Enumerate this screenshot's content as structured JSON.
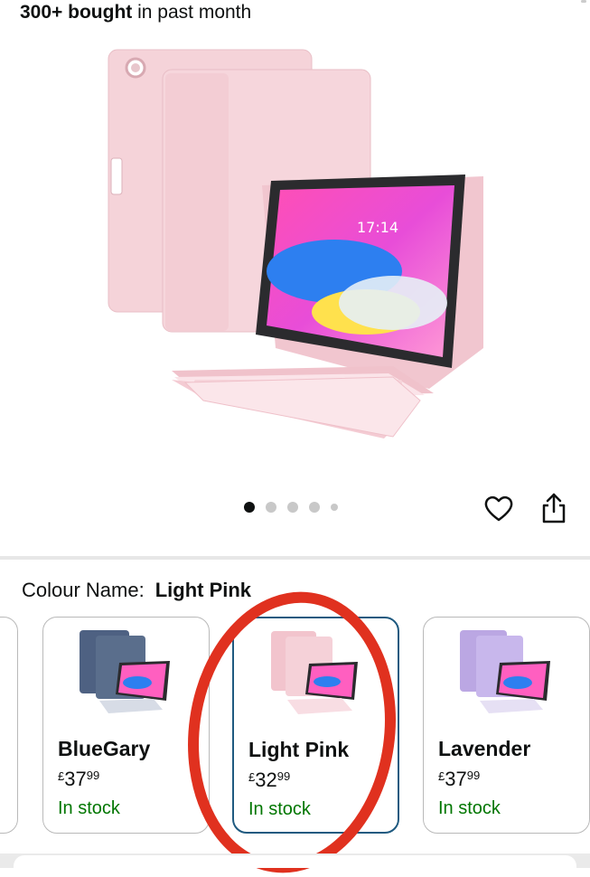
{
  "header": {
    "bought_bold": "300+ bought",
    "bought_rest": " in past month"
  },
  "hero": {
    "screen_time": "17:14",
    "carousel_total": 5,
    "carousel_active": 1
  },
  "colour": {
    "label": "Colour Name:",
    "value": "Light Pink"
  },
  "variants": [
    {
      "name": "BlueGary",
      "currency": "£",
      "whole": "37",
      "cents": "99",
      "stock": "In stock",
      "color": "#5a6e8c"
    },
    {
      "name": "Light Pink",
      "currency": "£",
      "whole": "32",
      "cents": "99",
      "stock": "In stock",
      "color": "#f2c9d2"
    },
    {
      "name": "Lavender",
      "currency": "£",
      "whole": "37",
      "cents": "99",
      "stock": "In stock",
      "color": "#c4b3e8"
    }
  ],
  "colors": {
    "selected_border": "#1f5a80",
    "stock_green": "#007600",
    "annotation_red": "#e0311f"
  },
  "icons": [
    "heart-icon",
    "share-icon"
  ]
}
